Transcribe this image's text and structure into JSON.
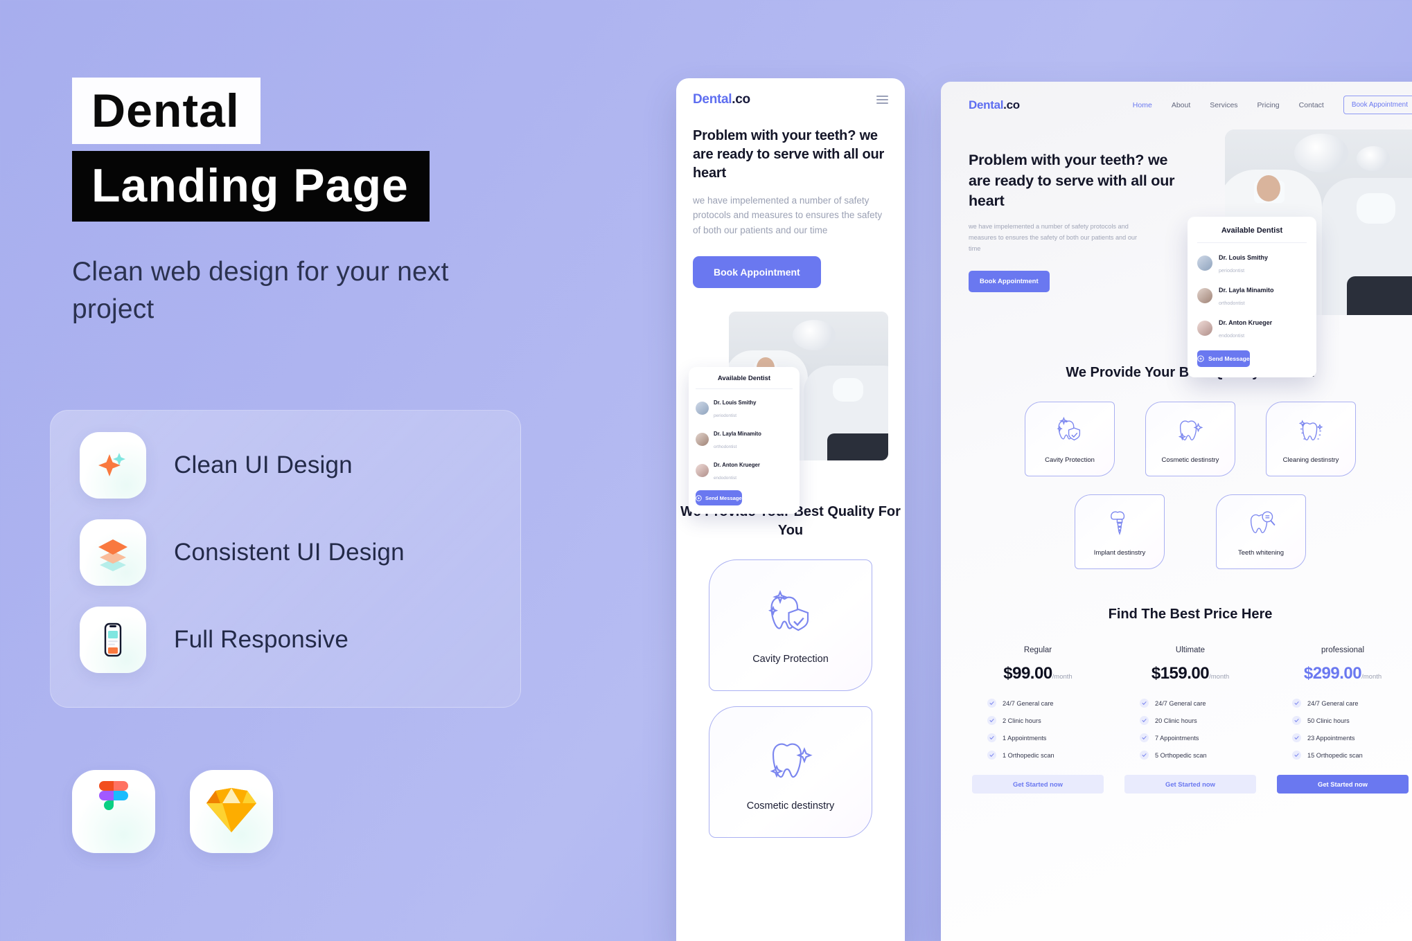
{
  "promo": {
    "title_line1": "Dental",
    "title_line2": "Landing Page",
    "subtitle": "Clean web design for your next project",
    "features": [
      {
        "label": "Clean UI Design",
        "icon": "sparkle-icon"
      },
      {
        "label": "Consistent UI Design",
        "icon": "layers-icon"
      },
      {
        "label": "Full Responsive",
        "icon": "phone-icon"
      }
    ],
    "tools": [
      {
        "name": "figma-logo"
      },
      {
        "name": "sketch-logo"
      }
    ]
  },
  "mobile": {
    "logo_brand": "Dental",
    "logo_suffix": ".co",
    "menu_icon": "hamburger-icon",
    "heading": "Problem with your teeth? we are ready to serve with all our heart",
    "paragraph": "we have impelemented a number of safety protocols and measures to ensures the safety of both our patients and our time",
    "cta": "Book Appointment",
    "dentist_card": {
      "title": "Available Dentist",
      "dentists": [
        {
          "name": "Dr. Louis Smithy",
          "role": "periodontist"
        },
        {
          "name": "Dr. Layla Minamito",
          "role": "orthodontist"
        },
        {
          "name": "Dr. Anton Krueger",
          "role": "endodontist"
        }
      ],
      "send_label": "Send Message"
    },
    "section_title": "We Provide Your Best Quality For You",
    "cards": [
      {
        "label": "Cavity Protection",
        "icon": "tooth-shield-icon"
      },
      {
        "label": "Cosmetic destinstry",
        "icon": "tooth-sparkle-icon"
      }
    ]
  },
  "desktop": {
    "logo_brand": "Dental",
    "logo_suffix": ".co",
    "nav": [
      {
        "label": "Home",
        "active": true
      },
      {
        "label": "About",
        "active": false
      },
      {
        "label": "Services",
        "active": false
      },
      {
        "label": "Pricing",
        "active": false
      },
      {
        "label": "Contact",
        "active": false
      }
    ],
    "nav_cta": "Book Appointment",
    "heading": "Problem with your teeth? we are ready to serve with all our heart",
    "paragraph": "we have impelemented a number of safety protocols and measures to ensures the safety of both our patients and our time",
    "cta": "Book Appointment",
    "dentist_card": {
      "title": "Available Dentist",
      "dentists": [
        {
          "name": "Dr. Louis Smithy",
          "role": "periodontist"
        },
        {
          "name": "Dr. Layla Minamito",
          "role": "orthodontist"
        },
        {
          "name": "Dr. Anton Krueger",
          "role": "endodontist"
        }
      ],
      "send_label": "Send Message"
    },
    "services_title": "We Provide Your Best Quality For You",
    "services_row1": [
      {
        "label": "Cavity Protection",
        "icon": "tooth-shield-icon"
      },
      {
        "label": "Cosmetic destinstry",
        "icon": "tooth-sparkle-icon"
      },
      {
        "label": "Cleaning destinstry",
        "icon": "tooth-clean-icon"
      }
    ],
    "services_row2": [
      {
        "label": "Implant destinstry",
        "icon": "tooth-implant-icon"
      },
      {
        "label": "Teeth whitening",
        "icon": "tooth-magnifier-icon"
      }
    ],
    "pricing_title": "Find The Best Price Here",
    "plans": [
      {
        "name": "Regular",
        "price": "$99.00",
        "per": "/month",
        "featured": false,
        "features": [
          "24/7 General care",
          "2 Clinic hours",
          "1 Appointments",
          "1 Orthopedic scan"
        ],
        "button": "Get Started now"
      },
      {
        "name": "Ultimate",
        "price": "$159.00",
        "per": "/month",
        "featured": false,
        "features": [
          "24/7 General care",
          "20 Clinic hours",
          "7 Appointments",
          "5 Orthopedic scan"
        ],
        "button": "Get Started now"
      },
      {
        "name": "professional",
        "price": "$299.00",
        "per": "/month",
        "featured": true,
        "features": [
          "24/7 General care",
          "50 Clinic hours",
          "23 Appointments",
          "15 Orthopedic scan"
        ],
        "button": "Get Started now"
      }
    ]
  },
  "colors": {
    "accent": "#6a78f0",
    "background": "#aeb4f0",
    "dark": "#050505",
    "orange": "#f9793f",
    "cyan": "#7fe6e0"
  }
}
